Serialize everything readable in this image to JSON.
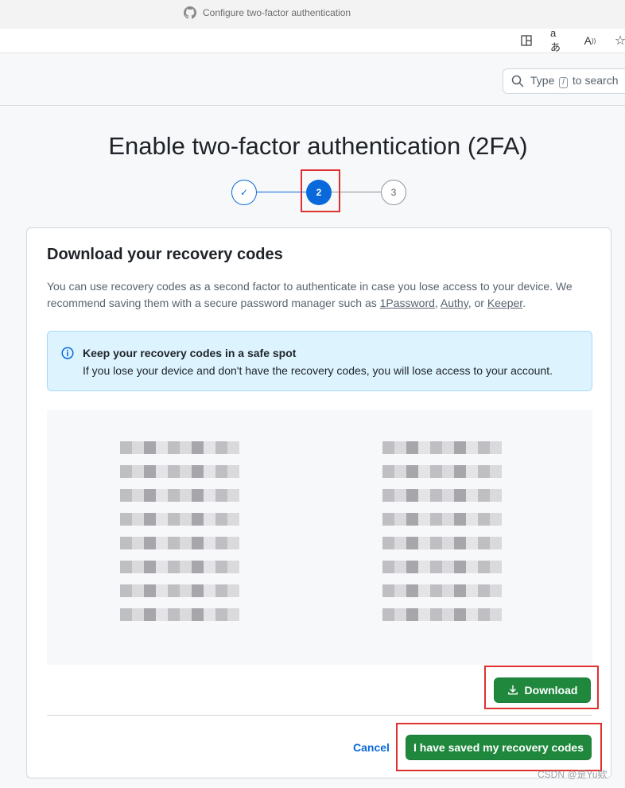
{
  "browser": {
    "tab_title": "Configure two-factor authentication",
    "toolbar_icons": [
      "split-screen-icon",
      "translate-icon",
      "read-aloud-icon",
      "favorite-star-icon"
    ]
  },
  "header": {
    "search_prefix": "Type",
    "search_key": "/",
    "search_suffix": "to search"
  },
  "page": {
    "title": "Enable two-factor authentication (2FA)",
    "steps": [
      {
        "label": "✓",
        "state": "complete"
      },
      {
        "label": "2",
        "state": "active"
      },
      {
        "label": "3",
        "state": "pending"
      }
    ]
  },
  "card": {
    "title": "Download your recovery codes",
    "desc_prefix": "You can use recovery codes as a second factor to authenticate in case you lose access to your device. We recommend saving them with a secure password manager such as ",
    "link_1password": "1Password",
    "sep1": ", ",
    "link_authy": "Authy",
    "sep2": ", or ",
    "link_keeper": "Keeper",
    "desc_suffix": ".",
    "flash_title": "Keep your recovery codes in a safe spot",
    "flash_body": "If you lose your device and don't have the recovery codes, you will lose access to your account.",
    "download_label": "Download",
    "cancel_label": "Cancel",
    "saved_label": "I have saved my recovery codes"
  },
  "watermark": "CSDN @是Yu欸",
  "colors": {
    "primary_green": "#1f883d",
    "link_blue": "#0969da",
    "flash_bg": "#ddf4ff",
    "annotation_red": "#e03030"
  }
}
